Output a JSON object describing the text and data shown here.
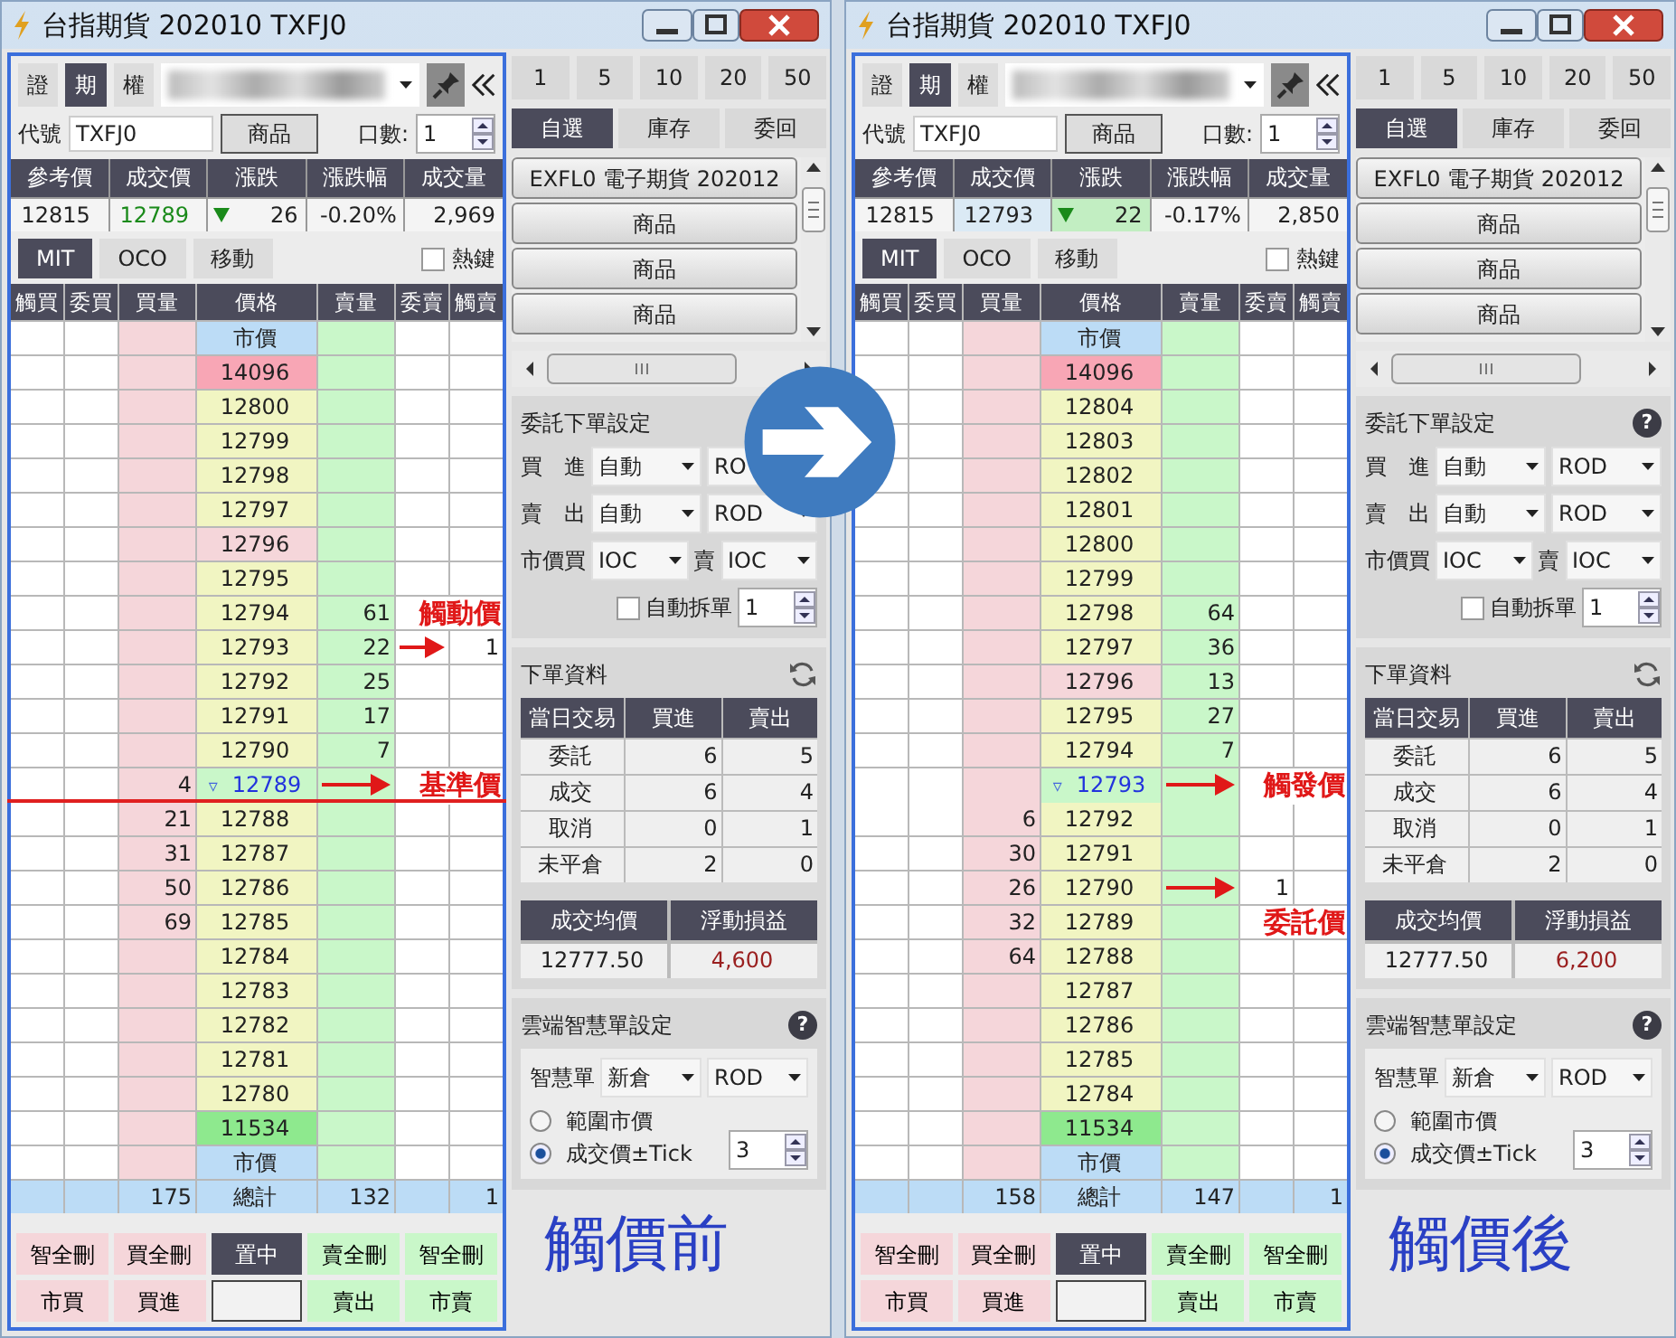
{
  "windows": [
    {
      "title": "台指期貨 202010 TXFJ0",
      "market_tabs": [
        {
          "label": "證",
          "selected": false
        },
        {
          "label": "期",
          "selected": true
        },
        {
          "label": "權",
          "selected": false
        }
      ],
      "code_label": "代號",
      "code": "TXFJ0",
      "product_button": "商品",
      "qty_label": "口數:",
      "qty": "1",
      "quote": {
        "columns": [
          "參考價",
          "成交價",
          "漲跌",
          "漲跌幅",
          "成交量"
        ],
        "values": [
          "12815",
          "12789",
          "26",
          "-0.20%",
          "2,969"
        ],
        "falling": true,
        "flash": false
      },
      "mode_tabs": [
        {
          "label": "MIT",
          "selected": true
        },
        {
          "label": "OCO",
          "selected": false
        },
        {
          "label": "移動",
          "selected": false
        }
      ],
      "hotkey": {
        "label": "熱鍵",
        "checked": false
      },
      "ladder": {
        "columns": [
          "觸買",
          "委買",
          "買量",
          "價格",
          "賣量",
          "委賣",
          "觸賣"
        ],
        "rows": [
          {
            "kind": "market",
            "cells": [
              "",
              "",
              "",
              "市價",
              "",
              "",
              ""
            ]
          },
          {
            "kind": "up-limit",
            "cells": [
              "",
              "",
              "",
              "14096",
              "",
              "",
              ""
            ]
          },
          {
            "kind": "normal",
            "cells": [
              "",
              "",
              "",
              "12800",
              "",
              "",
              ""
            ]
          },
          {
            "kind": "normal",
            "cells": [
              "",
              "",
              "",
              "12799",
              "",
              "",
              ""
            ]
          },
          {
            "kind": "normal",
            "cells": [
              "",
              "",
              "",
              "12798",
              "",
              "",
              ""
            ]
          },
          {
            "kind": "normal",
            "cells": [
              "",
              "",
              "",
              "12797",
              "",
              "",
              ""
            ]
          },
          {
            "kind": "open",
            "cells": [
              "",
              "",
              "",
              "12796",
              "",
              "",
              ""
            ]
          },
          {
            "kind": "normal",
            "cells": [
              "",
              "",
              "",
              "12795",
              "",
              "",
              ""
            ]
          },
          {
            "kind": "normal",
            "cells": [
              "",
              "",
              "",
              "12794",
              "61",
              "",
              ""
            ]
          },
          {
            "kind": "normal",
            "annotation": {
              "text": "觸動價",
              "kind": "above"
            },
            "cells": [
              "",
              "",
              "",
              "12793",
              "22",
              "",
              "1"
            ]
          },
          {
            "kind": "normal",
            "cells": [
              "",
              "",
              "",
              "12792",
              "25",
              "",
              ""
            ]
          },
          {
            "kind": "normal",
            "cells": [
              "",
              "",
              "",
              "12791",
              "17",
              "",
              ""
            ]
          },
          {
            "kind": "normal",
            "cells": [
              "",
              "",
              "",
              "12790",
              "7",
              "",
              ""
            ]
          },
          {
            "kind": "last",
            "marker": "▿",
            "rule_below": true,
            "annotation": {
              "text": "基準價",
              "kind": "right"
            },
            "cells": [
              "",
              "",
              "4",
              "12789",
              "",
              "",
              ""
            ]
          },
          {
            "kind": "normal",
            "cells": [
              "",
              "",
              "21",
              "12788",
              "",
              "",
              ""
            ]
          },
          {
            "kind": "normal",
            "cells": [
              "",
              "",
              "31",
              "12787",
              "",
              "",
              ""
            ]
          },
          {
            "kind": "normal",
            "cells": [
              "",
              "",
              "50",
              "12786",
              "",
              "",
              ""
            ]
          },
          {
            "kind": "normal",
            "cells": [
              "",
              "",
              "69",
              "12785",
              "",
              "",
              ""
            ]
          },
          {
            "kind": "normal",
            "cells": [
              "",
              "",
              "",
              "12784",
              "",
              "",
              ""
            ]
          },
          {
            "kind": "normal",
            "cells": [
              "",
              "",
              "",
              "12783",
              "",
              "",
              ""
            ]
          },
          {
            "kind": "normal",
            "cells": [
              "",
              "",
              "",
              "12782",
              "",
              "",
              ""
            ]
          },
          {
            "kind": "normal",
            "cells": [
              "",
              "",
              "",
              "12781",
              "",
              "",
              ""
            ]
          },
          {
            "kind": "normal",
            "cells": [
              "",
              "",
              "",
              "12780",
              "",
              "",
              ""
            ]
          },
          {
            "kind": "down-limit",
            "cells": [
              "",
              "",
              "",
              "11534",
              "",
              "",
              ""
            ]
          },
          {
            "kind": "market",
            "cells": [
              "",
              "",
              "",
              "市價",
              "",
              "",
              ""
            ]
          },
          {
            "kind": "total",
            "cells": [
              "",
              "",
              "175",
              "總計",
              "132",
              "",
              "1"
            ]
          }
        ]
      },
      "bottom_buttons": [
        [
          {
            "label": "智全刪",
            "kind": "buy"
          },
          {
            "label": "買全刪",
            "kind": "buy"
          },
          {
            "label": "置中",
            "kind": "center"
          },
          {
            "label": "賣全刪",
            "kind": "sell"
          },
          {
            "label": "智全刪",
            "kind": "sell"
          }
        ],
        [
          {
            "label": "市買",
            "kind": "buy"
          },
          {
            "label": "買進",
            "kind": "buy"
          },
          {
            "kind": "field"
          },
          {
            "label": "賣出",
            "kind": "sell"
          },
          {
            "label": "市賣",
            "kind": "sell"
          }
        ]
      ],
      "qty_buttons": [
        "1",
        "5",
        "10",
        "20",
        "50"
      ],
      "list_tabs": [
        {
          "label": "自選",
          "selected": true
        },
        {
          "label": "庫存",
          "selected": false
        },
        {
          "label": "委回",
          "selected": false
        }
      ],
      "product_list": [
        "EXFL0 電子期貨 202012",
        "商品",
        "商品",
        "商品"
      ],
      "order_settings": {
        "title": "委託下單設定",
        "rows": [
          [
            {
              "kind": "label",
              "text": "買　進"
            },
            {
              "kind": "select",
              "text": "自動"
            },
            {
              "kind": "select",
              "text": "RO"
            }
          ],
          [
            {
              "kind": "label",
              "text": "賣　出"
            },
            {
              "kind": "select",
              "text": "自動"
            },
            {
              "kind": "select",
              "text": "ROD"
            }
          ],
          [
            {
              "kind": "label",
              "text": "市價買"
            },
            {
              "kind": "select",
              "text": "IOC"
            },
            {
              "kind": "label",
              "text": "賣"
            },
            {
              "kind": "select",
              "text": "IOC"
            }
          ]
        ],
        "auto_split": {
          "label": "自動拆單",
          "checked": false,
          "value": "1"
        }
      },
      "order_info": {
        "title": "下單資料",
        "columns": [
          "當日交易",
          "買進",
          "賣出"
        ],
        "rows": [
          [
            "委託",
            "6",
            "5"
          ],
          [
            "成交",
            "6",
            "4"
          ],
          [
            "取消",
            "0",
            "1"
          ],
          [
            "未平倉",
            "2",
            "0"
          ]
        ],
        "summary_columns": [
          "成交均價",
          "浮動損益"
        ],
        "summary_values": [
          "12777.50",
          "4,600"
        ]
      },
      "smart_order": {
        "title": "雲端智慧單設定",
        "help": "?",
        "label": "智慧單",
        "selects": [
          "新倉",
          "ROD"
        ],
        "options": [
          {
            "label": "範圍市價",
            "selected": false
          },
          {
            "label": "成交價±Tick",
            "selected": true
          }
        ],
        "ticks": "3"
      },
      "caption": "觸價前"
    },
    {
      "title": "台指期貨 202010 TXFJ0",
      "market_tabs": [
        {
          "label": "證",
          "selected": false
        },
        {
          "label": "期",
          "selected": true
        },
        {
          "label": "權",
          "selected": false
        }
      ],
      "code_label": "代號",
      "code": "TXFJ0",
      "product_button": "商品",
      "qty_label": "口數:",
      "qty": "1",
      "quote": {
        "columns": [
          "參考價",
          "成交價",
          "漲跌",
          "漲跌幅",
          "成交量"
        ],
        "values": [
          "12815",
          "12793",
          "22",
          "-0.17%",
          "2,850"
        ],
        "falling": true,
        "flash": true
      },
      "mode_tabs": [
        {
          "label": "MIT",
          "selected": true
        },
        {
          "label": "OCO",
          "selected": false
        },
        {
          "label": "移動",
          "selected": false
        }
      ],
      "hotkey": {
        "label": "熱鍵",
        "checked": false
      },
      "ladder": {
        "columns": [
          "觸買",
          "委買",
          "買量",
          "價格",
          "賣量",
          "委賣",
          "觸賣"
        ],
        "rows": [
          {
            "kind": "market",
            "cells": [
              "",
              "",
              "",
              "市價",
              "",
              "",
              ""
            ]
          },
          {
            "kind": "up-limit",
            "cells": [
              "",
              "",
              "",
              "14096",
              "",
              "",
              ""
            ]
          },
          {
            "kind": "normal",
            "cells": [
              "",
              "",
              "",
              "12804",
              "",
              "",
              ""
            ]
          },
          {
            "kind": "normal",
            "cells": [
              "",
              "",
              "",
              "12803",
              "",
              "",
              ""
            ]
          },
          {
            "kind": "normal",
            "cells": [
              "",
              "",
              "",
              "12802",
              "",
              "",
              ""
            ]
          },
          {
            "kind": "normal",
            "cells": [
              "",
              "",
              "",
              "12801",
              "",
              "",
              ""
            ]
          },
          {
            "kind": "normal",
            "cells": [
              "",
              "",
              "",
              "12800",
              "",
              "",
              ""
            ]
          },
          {
            "kind": "normal",
            "cells": [
              "",
              "",
              "",
              "12799",
              "",
              "",
              ""
            ]
          },
          {
            "kind": "normal",
            "cells": [
              "",
              "",
              "",
              "12798",
              "64",
              "",
              ""
            ]
          },
          {
            "kind": "normal",
            "cells": [
              "",
              "",
              "",
              "12797",
              "36",
              "",
              ""
            ]
          },
          {
            "kind": "open",
            "cells": [
              "",
              "",
              "",
              "12796",
              "13",
              "",
              ""
            ]
          },
          {
            "kind": "normal",
            "cells": [
              "",
              "",
              "",
              "12795",
              "27",
              "",
              ""
            ]
          },
          {
            "kind": "normal",
            "cells": [
              "",
              "",
              "",
              "12794",
              "7",
              "",
              ""
            ]
          },
          {
            "kind": "last",
            "marker": "▿",
            "annotation": {
              "text": "觸發價",
              "kind": "right"
            },
            "cells": [
              "",
              "",
              "",
              "12793",
              "",
              "",
              ""
            ]
          },
          {
            "kind": "normal",
            "cells": [
              "",
              "",
              "6",
              "12792",
              "",
              "",
              ""
            ]
          },
          {
            "kind": "normal",
            "cells": [
              "",
              "",
              "30",
              "12791",
              "",
              "",
              ""
            ]
          },
          {
            "kind": "normal",
            "annotation": {
              "text": "委託價",
              "kind": "below"
            },
            "cells": [
              "",
              "",
              "26",
              "12790",
              "",
              "1",
              ""
            ]
          },
          {
            "kind": "normal",
            "cells": [
              "",
              "",
              "32",
              "12789",
              "",
              "",
              ""
            ]
          },
          {
            "kind": "normal",
            "cells": [
              "",
              "",
              "64",
              "12788",
              "",
              "",
              ""
            ]
          },
          {
            "kind": "normal",
            "cells": [
              "",
              "",
              "",
              "12787",
              "",
              "",
              ""
            ]
          },
          {
            "kind": "normal",
            "cells": [
              "",
              "",
              "",
              "12786",
              "",
              "",
              ""
            ]
          },
          {
            "kind": "normal",
            "cells": [
              "",
              "",
              "",
              "12785",
              "",
              "",
              ""
            ]
          },
          {
            "kind": "normal",
            "cells": [
              "",
              "",
              "",
              "12784",
              "",
              "",
              ""
            ]
          },
          {
            "kind": "down-limit",
            "cells": [
              "",
              "",
              "",
              "11534",
              "",
              "",
              ""
            ]
          },
          {
            "kind": "market",
            "cells": [
              "",
              "",
              "",
              "市價",
              "",
              "",
              ""
            ]
          },
          {
            "kind": "total",
            "cells": [
              "",
              "",
              "158",
              "總計",
              "147",
              "",
              "1"
            ]
          }
        ]
      },
      "bottom_buttons": [
        [
          {
            "label": "智全刪",
            "kind": "buy"
          },
          {
            "label": "買全刪",
            "kind": "buy"
          },
          {
            "label": "置中",
            "kind": "center"
          },
          {
            "label": "賣全刪",
            "kind": "sell"
          },
          {
            "label": "智全刪",
            "kind": "sell"
          }
        ],
        [
          {
            "label": "市買",
            "kind": "buy"
          },
          {
            "label": "買進",
            "kind": "buy"
          },
          {
            "kind": "field"
          },
          {
            "label": "賣出",
            "kind": "sell"
          },
          {
            "label": "市賣",
            "kind": "sell"
          }
        ]
      ],
      "qty_buttons": [
        "1",
        "5",
        "10",
        "20",
        "50"
      ],
      "list_tabs": [
        {
          "label": "自選",
          "selected": true
        },
        {
          "label": "庫存",
          "selected": false
        },
        {
          "label": "委回",
          "selected": false
        }
      ],
      "product_list": [
        "EXFL0 電子期貨 202012",
        "商品",
        "商品",
        "商品"
      ],
      "order_settings": {
        "title": "委託下單設定",
        "help": "?",
        "rows": [
          [
            {
              "kind": "label",
              "text": "買　進"
            },
            {
              "kind": "select",
              "text": "自動"
            },
            {
              "kind": "select",
              "text": "ROD"
            }
          ],
          [
            {
              "kind": "label",
              "text": "賣　出"
            },
            {
              "kind": "select",
              "text": "自動"
            },
            {
              "kind": "select",
              "text": "ROD"
            }
          ],
          [
            {
              "kind": "label",
              "text": "市價買"
            },
            {
              "kind": "select",
              "text": "IOC"
            },
            {
              "kind": "label",
              "text": "賣"
            },
            {
              "kind": "select",
              "text": "IOC"
            }
          ]
        ],
        "auto_split": {
          "label": "自動拆單",
          "checked": false,
          "value": "1"
        }
      },
      "order_info": {
        "title": "下單資料",
        "columns": [
          "當日交易",
          "買進",
          "賣出"
        ],
        "rows": [
          [
            "委託",
            "6",
            "5"
          ],
          [
            "成交",
            "6",
            "4"
          ],
          [
            "取消",
            "0",
            "1"
          ],
          [
            "未平倉",
            "2",
            "0"
          ]
        ],
        "summary_columns": [
          "成交均價",
          "浮動損益"
        ],
        "summary_values": [
          "12777.50",
          "6,200"
        ]
      },
      "smart_order": {
        "title": "雲端智慧單設定",
        "help": "?",
        "label": "智慧單",
        "selects": [
          "新倉",
          "ROD"
        ],
        "options": [
          {
            "label": "範圍市價",
            "selected": false
          },
          {
            "label": "成交價±Tick",
            "selected": true
          }
        ],
        "ticks": "3"
      },
      "caption": "觸價後"
    }
  ]
}
